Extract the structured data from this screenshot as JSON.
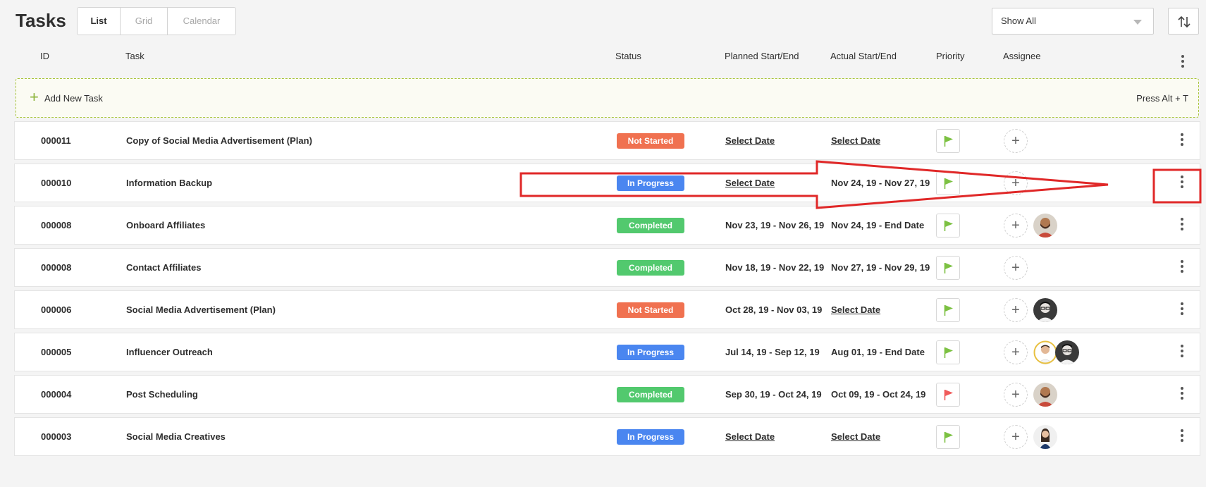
{
  "header": {
    "title": "Tasks",
    "views": [
      "List",
      "Grid",
      "Calendar"
    ],
    "active_view": "List",
    "filter_value": "Show All"
  },
  "columns": {
    "id": "ID",
    "task": "Task",
    "status": "Status",
    "planned": "Planned Start/End",
    "actual": "Actual Start/End",
    "priority": "Priority",
    "assignee": "Assignee"
  },
  "add_task": {
    "label": "Add New Task",
    "shortcut": "Press Alt + T"
  },
  "colors": {
    "not_started": "#f07150",
    "in_progress": "#4a86f0",
    "completed": "#52c96e",
    "flag_green": "#7cc142",
    "flag_red": "#f05a5a",
    "annotation_red": "#e02828"
  },
  "rows": [
    {
      "id": "000011",
      "task": "Copy of Social Media Advertisement (Plan)",
      "status": "Not Started",
      "status_key": "not_started",
      "planned": "Select Date",
      "planned_link": true,
      "actual": "Select Date",
      "actual_link": true,
      "flag": "green-flag-icon",
      "assignees": []
    },
    {
      "id": "000010",
      "task": "Information Backup",
      "status": "In Progress",
      "status_key": "in_progress",
      "planned": "Select Date",
      "planned_link": true,
      "actual": "Nov 24, 19 - Nov 27, 19",
      "actual_link": false,
      "flag": "green-flag-icon",
      "assignees": []
    },
    {
      "id": "000008",
      "task": "Onboard Affiliates",
      "status": "Completed",
      "status_key": "completed",
      "planned": "Nov 23, 19 - Nov 26, 19",
      "planned_link": false,
      "actual": "Nov 24, 19 - End Date",
      "actual_link": false,
      "flag": "green-flag-icon",
      "assignees": [
        "avatar-man-beard"
      ]
    },
    {
      "id": "000008",
      "task": "Contact Affiliates",
      "status": "Completed",
      "status_key": "completed",
      "planned": "Nov 18, 19 - Nov 22, 19",
      "planned_link": false,
      "actual": "Nov 27, 19 - Nov 29, 19",
      "actual_link": false,
      "flag": "green-flag-icon",
      "assignees": []
    },
    {
      "id": "000006",
      "task": "Social Media Advertisement (Plan)",
      "status": "Not Started",
      "status_key": "not_started",
      "planned": "Oct 28, 19 - Nov 03, 19",
      "planned_link": false,
      "actual": "Select Date",
      "actual_link": true,
      "flag": "green-flag-icon",
      "assignees": [
        "avatar-man-glasses"
      ]
    },
    {
      "id": "000005",
      "task": "Influencer Outreach",
      "status": "In Progress",
      "status_key": "in_progress",
      "planned": "Jul 14, 19 - Sep 12, 19",
      "planned_link": false,
      "actual": "Aug 01, 19 - End Date",
      "actual_link": false,
      "flag": "green-flag-icon",
      "assignees": [
        "avatar-man-white-shirt",
        "avatar-man-glasses"
      ]
    },
    {
      "id": "000004",
      "task": "Post Scheduling",
      "status": "Completed",
      "status_key": "completed",
      "planned": "Sep 30, 19 - Oct 24, 19",
      "planned_link": false,
      "actual": "Oct 09, 19 - Oct 24, 19",
      "actual_link": false,
      "flag": "red-flag-icon",
      "assignees": [
        "avatar-man-beard"
      ]
    },
    {
      "id": "000003",
      "task": "Social Media Creatives",
      "status": "In Progress",
      "status_key": "in_progress",
      "planned": "Select Date",
      "planned_link": true,
      "actual": "Select Date",
      "actual_link": true,
      "flag": "green-flag-icon",
      "assignees": [
        "avatar-woman"
      ]
    }
  ]
}
